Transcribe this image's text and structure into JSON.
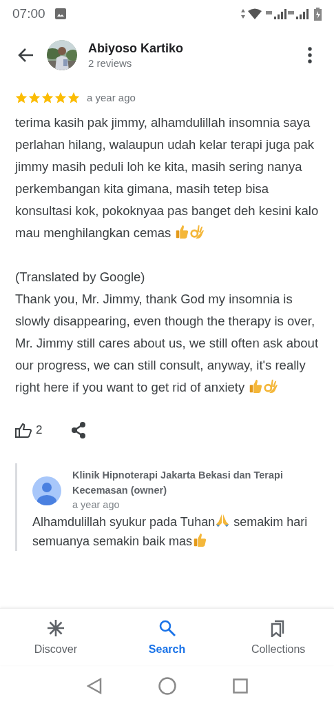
{
  "status_bar": {
    "time": "07:00"
  },
  "header": {
    "name": "Abiyoso Kartiko",
    "subtitle": "2 reviews"
  },
  "review": {
    "stars": 5,
    "time": "a year ago",
    "original": [
      {
        "kind": "text",
        "text": "terima kasih pak jimmy, alhamdulillah insomnia saya perlahan hilang, walaupun udah kelar terapi juga pak jimmy masih peduli loh ke kita, masih sering nanya perkembangan kita gimana, masih tetep bisa konsultasi kok, pokoknyaa pas banget deh kesini kalo mau menghilangkan cemas "
      },
      {
        "kind": "thumbs_up"
      },
      {
        "kind": "ok_hand"
      }
    ],
    "translation_note": "(Translated by Google)",
    "translated": [
      {
        "kind": "text",
        "text": "Thank you, Mr. Jimmy, thank God my insomnia is slowly disappearing, even though the therapy is over, Mr. Jimmy still cares about us, we still often ask about our progress, we can still consult, anyway, it's really right here if you want to get rid of anxiety "
      },
      {
        "kind": "thumbs_up"
      },
      {
        "kind": "ok_hand"
      }
    ],
    "likes": "2"
  },
  "reply": {
    "author": "Klinik Hipnoterapi Jakarta Bekasi dan Terapi Kecemasan (owner)",
    "time": "a year ago",
    "body": [
      {
        "kind": "text",
        "text": "Alhamdulillah syukur pada Tuhan"
      },
      {
        "kind": "pray"
      },
      {
        "kind": "text",
        "text": " semakim hari semuanya semakin baik mas"
      },
      {
        "kind": "thumbs_up"
      }
    ]
  },
  "bottom_nav": [
    {
      "label": "Discover",
      "kind": "discover",
      "selected": false
    },
    {
      "label": "Search",
      "kind": "search",
      "selected": true
    },
    {
      "label": "Collections",
      "kind": "collections",
      "selected": false
    }
  ]
}
